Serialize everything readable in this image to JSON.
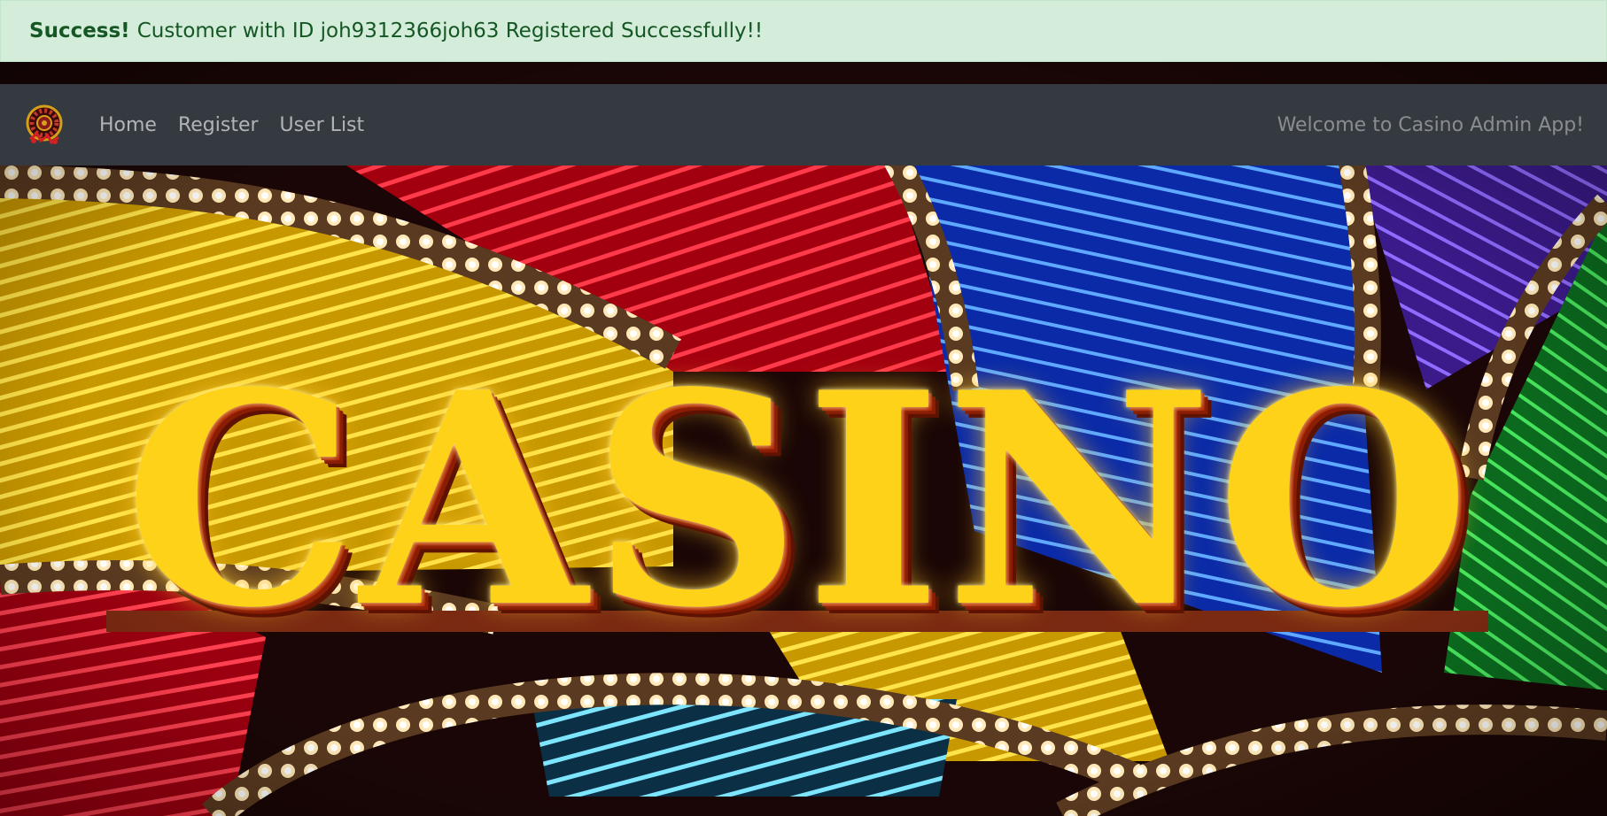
{
  "alert": {
    "strong": "Success!",
    "message": "Customer with ID joh9312366joh63 Registered Successfully!!",
    "background": "#d4edda",
    "text_color": "#155724"
  },
  "navbar": {
    "brand_icon": "roulette-wheel-logo-icon",
    "links": [
      {
        "label": "Home"
      },
      {
        "label": "Register"
      },
      {
        "label": "User List"
      }
    ],
    "welcome_text": "Welcome to Casino Admin App!",
    "background": "#343a40"
  },
  "hero": {
    "sign_letters": [
      "C",
      "A",
      "S",
      "I",
      "N",
      "O"
    ]
  }
}
